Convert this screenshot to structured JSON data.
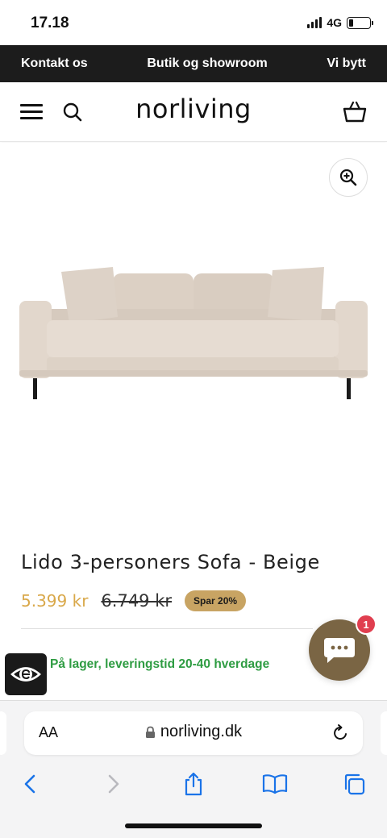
{
  "status": {
    "time": "17.18",
    "network": "4G",
    "battery_level": 0.2
  },
  "announcement": {
    "links": [
      "Kontakt os",
      "Butik og showroom",
      "Vi bytt"
    ]
  },
  "header": {
    "logo": "norliving"
  },
  "product": {
    "image": "sofa",
    "title": "Lido 3-personers Sofa - Beige",
    "price": "5.399 kr",
    "old_price": "6.749 kr",
    "discount_badge": "Spar 20%",
    "stock": "På lager, leveringstid 20-40 hverdage"
  },
  "chat": {
    "unread_count": "1"
  },
  "browser": {
    "aa_label": "AA",
    "url": "norliving.dk"
  },
  "colors": {
    "announce_bg": "#1c1c1c",
    "sale_price": "#d9a84a",
    "badge_bg": "#c8a463",
    "stock_green": "#2e9c42",
    "chat_bg": "#7a6544",
    "notification_red": "#e03e4f",
    "browser_accent": "#1a73e8"
  },
  "icons": [
    "hamburger-icon",
    "search-icon",
    "basket-icon",
    "zoom-in-icon",
    "chat-icon",
    "trust-eye-icon",
    "lock-icon",
    "reload-icon",
    "back-icon",
    "forward-icon",
    "share-icon",
    "bookmarks-icon",
    "tabs-icon"
  ]
}
